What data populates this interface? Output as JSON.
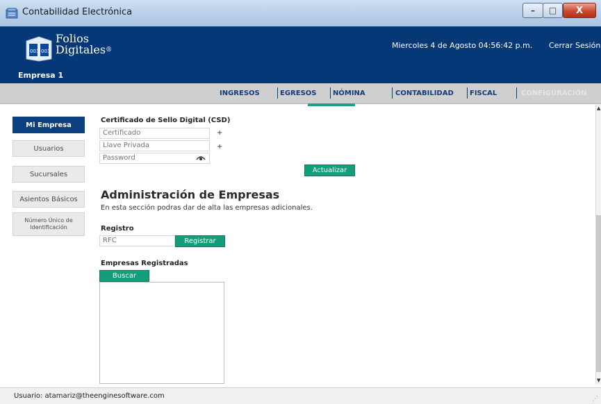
{
  "window": {
    "title": "Contabilidad Electrónica",
    "controls": {
      "minimize": "–",
      "maximize": "□",
      "close": "X"
    }
  },
  "header": {
    "logo_line1": "Folios",
    "logo_line2": "Digitales",
    "logo_mark": "®",
    "company": "Empresa 1",
    "datetime": "Miercoles 4 de Agosto 04:56:42 p.m.",
    "logout": "Cerrar Sesión",
    "bg_color": "#053877"
  },
  "nav": {
    "items": [
      "INGRESOS",
      "EGRESOS",
      "NÓMINA",
      "CONTABILIDAD",
      "FISCAL",
      "CONFIGURACIÓN"
    ],
    "active": "NÓMINA",
    "accent_color": "#1f9e89"
  },
  "sidebar": {
    "items": [
      {
        "label": "Mi Empresa",
        "active": true
      },
      {
        "label": "Usuarios",
        "active": false
      },
      {
        "label": "Sucursales",
        "active": false
      },
      {
        "label": "Asientos Básicos",
        "active": false
      },
      {
        "label": "Número Único de Identificación",
        "active": false
      }
    ]
  },
  "csd": {
    "title": "Certificado de Sello Digital (CSD)",
    "certificado_placeholder": "Certificado",
    "llave_placeholder": "Llave Privada",
    "password_placeholder": "Password",
    "plus": "+",
    "update_button": "Actualizar"
  },
  "admin": {
    "title": "Administración de Empresas",
    "description": "En esta sección podras dar de alta las empresas adicionales."
  },
  "registro": {
    "title": "Registro",
    "rfc_placeholder": "RFC",
    "register_button": "Registrar"
  },
  "empresas": {
    "title": "Empresas Registradas",
    "search_button": "Buscar"
  },
  "status": {
    "user": "Usuario: atamariz@theenginesoftware.com"
  },
  "icons": {
    "app": "ledger-icon",
    "logo": "folders-logo-icon",
    "password_toggle": "eye-icon",
    "scroll_up": "arrow-up-icon",
    "scroll_down": "arrow-down-icon",
    "resize": "resize-grip-icon"
  }
}
